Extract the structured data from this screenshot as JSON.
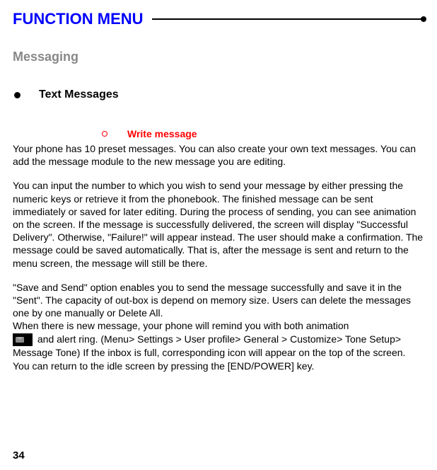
{
  "header": {
    "title": "FUNCTION MENU"
  },
  "section": {
    "title": "Messaging",
    "subsection": {
      "title": "Text Messages"
    },
    "item": {
      "title": "Write message"
    }
  },
  "paragraphs": {
    "p1": "Your phone has 10 preset messages. You can also create your own text messages. You can add the message module to the new message you are editing.",
    "p2": "You can input the number to which you wish to send your message by either pressing the numeric keys or retrieve it from the phonebook. The finished message can be sent immediately or saved for later editing. During the process of sending, you can see animation on the screen. If the message is successfully delivered, the screen will display \"Successful Delivery\". Otherwise, \"Failure!\" will appear instead. The user should make a confirmation. The message could be saved automatically. That is, after the message is sent and return to the menu screen, the message will still be there.",
    "p3": "\"Save and Send\" option enables you to send the message successfully and save it in the \"Sent\". The capacity of out-box is depend on memory size. Users can delete the messages one by one manually or Delete All.",
    "p4": "When there is new message, your phone will remind you with both animation",
    "p5": " and alert ring. (Menu> Settings > User profile> General > Customize> Tone Setup> Message Tone)    If the inbox is full, corresponding icon will appear on the top of the screen. You can return to the idle screen by pressing the [END/POWER] key."
  },
  "page_number": "34"
}
